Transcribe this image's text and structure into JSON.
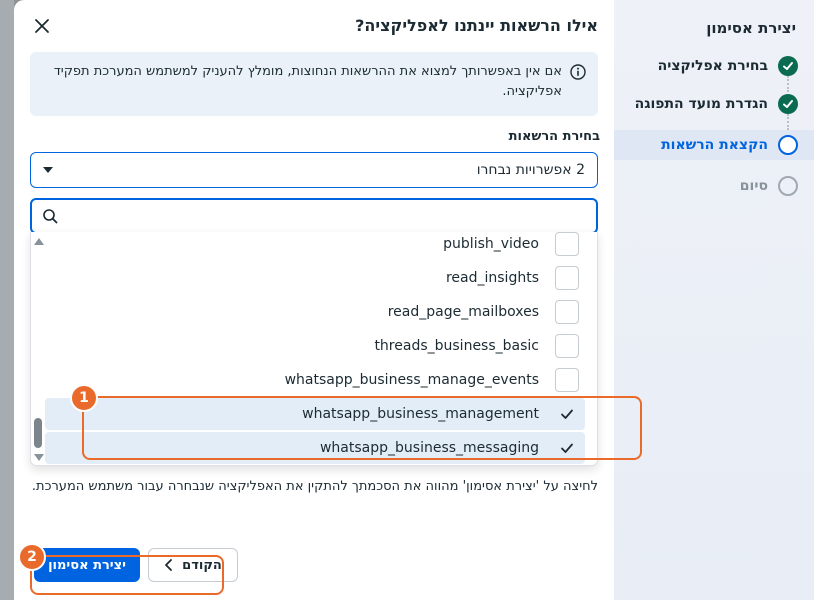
{
  "sidebar": {
    "title": "יצירת אסימון",
    "steps": [
      {
        "label": "בחירת אפליקציה",
        "status": "done"
      },
      {
        "label": "הגדרת מועד התפוגה",
        "status": "done"
      },
      {
        "label": "הקצאת הרשאות",
        "status": "current"
      },
      {
        "label": "סיום",
        "status": "todo"
      }
    ]
  },
  "dialog": {
    "title": "אילו הרשאות יינתנו לאפליקציה?",
    "close_icon": "close-icon",
    "info_text": "אם אין באפשרותך למצוא את ההרשאות הנחוצות, מומלץ להעניק למשתמש המערכת תפקיד אפליקציה.",
    "permissions_label": "בחירת הרשאות",
    "select_value": "2 אפשרויות נבחרו",
    "search_value": "",
    "options": [
      {
        "label": "publish_video",
        "checked": false
      },
      {
        "label": "read_insights",
        "checked": false
      },
      {
        "label": "read_page_mailboxes",
        "checked": false
      },
      {
        "label": "threads_business_basic",
        "checked": false
      },
      {
        "label": "whatsapp_business_manage_events",
        "checked": false
      },
      {
        "label": "whatsapp_business_management",
        "checked": true
      },
      {
        "label": "whatsapp_business_messaging",
        "checked": true
      }
    ],
    "footer_text": "לחיצה על 'יצירת אסימון' מהווה את הסכמתך להתקין את האפליקציה שנבחרה עבור משתמש המערכת.",
    "create_button": "יצירת אסימון",
    "back_button": "הקודם"
  },
  "annotations": [
    {
      "number": "1"
    },
    {
      "number": "2"
    }
  ],
  "colors": {
    "accent": "#0064e0",
    "done": "#0a6b50",
    "callout": "#ea6a2b"
  }
}
